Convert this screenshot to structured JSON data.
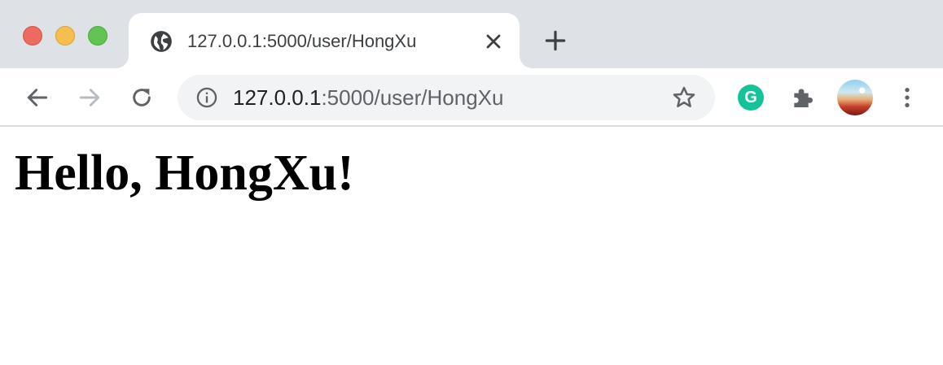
{
  "browser": {
    "tab": {
      "title": "127.0.0.1:5000/user/HongXu",
      "favicon": "globe-icon"
    },
    "toolbar": {
      "url_host": "127.0.0.1",
      "url_path": ":5000/user/HongXu"
    },
    "colors": {
      "tab_strip": "#dee1e6",
      "omnibox": "#f1f3f4",
      "grammarly": "#15c39a"
    },
    "extension_label": "G"
  },
  "page": {
    "heading": "Hello, HongXu!"
  }
}
